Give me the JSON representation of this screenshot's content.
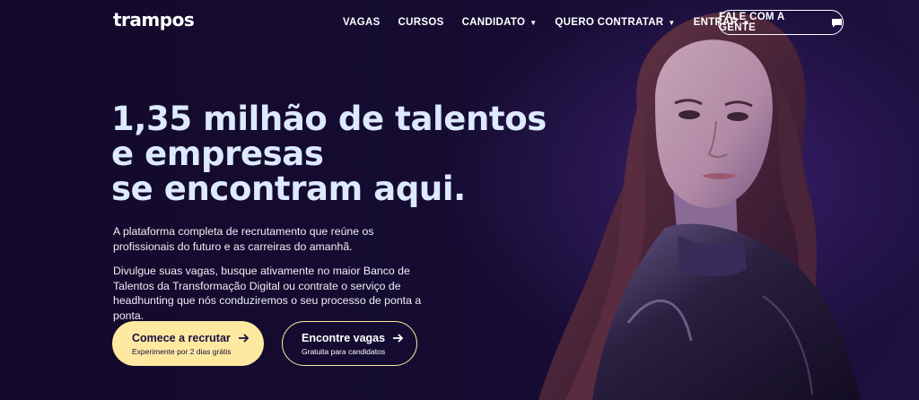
{
  "header": {
    "logo": "trampos",
    "nav": [
      {
        "label": "VAGAS",
        "dropdown": false
      },
      {
        "label": "CURSOS",
        "dropdown": false
      },
      {
        "label": "CANDIDATO",
        "dropdown": true
      },
      {
        "label": "QUERO CONTRATAR",
        "dropdown": true
      },
      {
        "label": "ENTRAR",
        "dropdown": true
      }
    ],
    "contact_label": "FALE COM A GENTE"
  },
  "hero": {
    "headline_lines": [
      "1,35 milhão de talentos",
      "e empresas",
      "se encontram aqui."
    ],
    "paragraph1": "A plataforma completa de recrutamento que reúne os profissionais do futuro e as carreiras do amanhã.",
    "paragraph2": "Divulgue suas vagas, busque ativamente no maior Banco de Talentos da Transformação Digital ou contrate o serviço de headhunting que nós conduziremos o seu processo de ponta a ponta."
  },
  "cta": {
    "primary": {
      "label": "Comece a recrutar",
      "sub": "Experimente por 2 dias grátis"
    },
    "secondary": {
      "label": "Encontre vagas",
      "sub": "Gratuita para candidatos"
    }
  },
  "colors": {
    "background": "#140b2e",
    "headline": "#dce9ff",
    "accent": "#fde9a0"
  }
}
